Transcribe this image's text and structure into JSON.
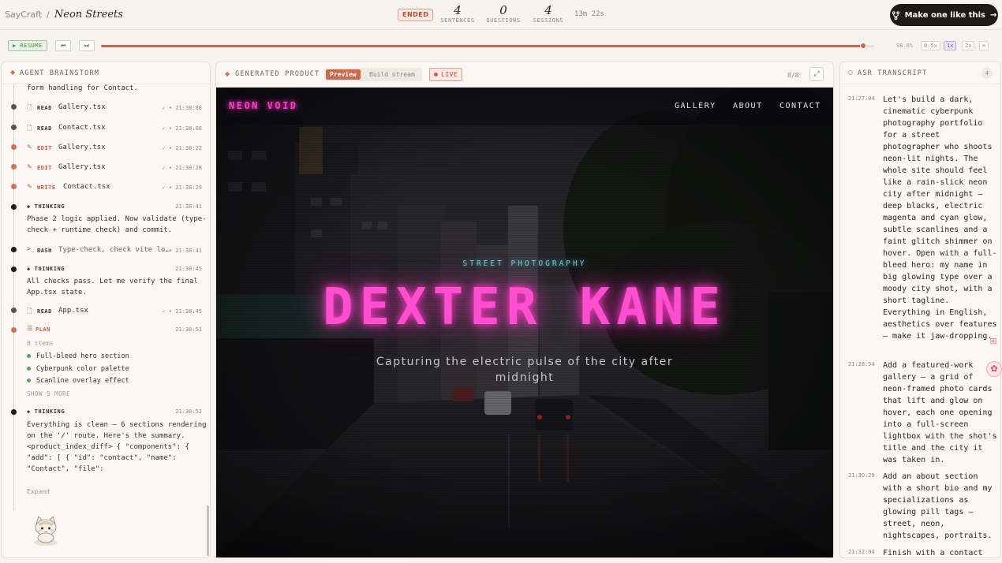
{
  "topbar": {
    "app_name": "SayCraft",
    "separator": "/",
    "project_name": "Neon Streets",
    "status": "ENDED",
    "stats": [
      {
        "value": "4",
        "label": "SENTENCES"
      },
      {
        "value": "0",
        "label": "QUESTIONS"
      },
      {
        "value": "4",
        "label": "SESSIONS"
      }
    ],
    "duration": "13m 22s",
    "make_button": "Make one like this",
    "make_button_icon": "fork-icon",
    "make_button_arrow": "→"
  },
  "playback": {
    "resume_label": "▶ RESUME",
    "prev_label": "⏮",
    "next_label": "⏭",
    "progress": 0.986,
    "progress_label": "98.6%",
    "speeds": [
      "0.5x",
      "1x",
      "2x",
      "∞"
    ],
    "active_speed": "1x",
    "accent_color": "#d0604a"
  },
  "agent": {
    "title": "AGENT BRAINSTORM",
    "header_icon": "diamond-icon",
    "truncated_text": "form handling for Contact.",
    "rows": [
      {
        "verb": "READ",
        "file": "Gallery.tsx",
        "status": "✓ •",
        "time": "21:38:08",
        "icon": "file-icon",
        "accent": false
      },
      {
        "verb": "READ",
        "file": "Contact.tsx",
        "status": "✓ •",
        "time": "21:38:08",
        "icon": "file-icon",
        "accent": false
      },
      {
        "verb": "EDIT",
        "file": "Gallery.tsx",
        "status": "✓ •",
        "time": "21:38:22",
        "icon": "pencil-icon",
        "accent": true
      },
      {
        "verb": "EDIT",
        "file": "Gallery.tsx",
        "status": "✓ •",
        "time": "21:38:28",
        "icon": "pencil-icon",
        "accent": true
      },
      {
        "verb": "WRITE",
        "file": "Contact.tsx",
        "status": "✓ •",
        "time": "21:38:29",
        "icon": "pencil-icon",
        "accent": true
      }
    ],
    "thinking1": {
      "label": "◆ THINKING",
      "time": "21:38:41",
      "text": "Phase 2 logic applied. Now validate (type-check + runtime check) and commit."
    },
    "bash": {
      "verb": "BASH",
      "text": "Type-check, check vite lo…",
      "status": "✓ •",
      "time": "21:38:41",
      "icon": "terminal-icon"
    },
    "thinking2": {
      "label": "◆ THINKING",
      "time": "21:38:45",
      "text": "All checks pass. Let me verify the final App.tsx state."
    },
    "read_app": {
      "verb": "READ",
      "file": "App.tsx",
      "status": "✓ •",
      "time": "21:38:45"
    },
    "plan": {
      "label": "PLAN",
      "time": "21:38:51",
      "count": "8 items",
      "items": [
        "Full-bleed hero section",
        "Cyberpunk color palette",
        "Scanline overlay effect"
      ],
      "more": "SHOW 5 MORE"
    },
    "thinking3": {
      "label": "◆ THINKING",
      "time": "21:38:52",
      "text": "Everything is clean — 6 sections rendering on the '/' route. Here's the summary. <product_index_diff> { \"components\": { \"add\": [ { \"id\": \"contact\", \"name\": \"Contact\", \"file\": \"src/sections/Contact.tsx …",
      "expand": "Expand"
    }
  },
  "product": {
    "title": "GENERATED PRODUCT",
    "tabs": [
      "Preview",
      "Build stream"
    ],
    "active_tab": "Preview",
    "live": "LIVE",
    "page_counter": "8/8",
    "site": {
      "logo": "NEON VOID",
      "nav": [
        "GALLERY",
        "ABOUT",
        "CONTACT"
      ],
      "eyebrow": "STREET PHOTOGRAPHY",
      "headline": "DEXTER KANE",
      "tagline": "Capturing the electric pulse of the city after midnight",
      "neon_magenta": "#ff3bc8",
      "neon_cyan": "#5fd7e0"
    }
  },
  "asr": {
    "title": "ASR TRANSCRIPT",
    "count": "4",
    "entries": [
      {
        "time": "21:27:04",
        "text": "Let's build a dark, cinematic cyberpunk photography portfolio for a street photographer who shoots neon-lit nights. The whole site should feel like a rain-slick neon city after midnight — deep blacks, electric magenta and cyan glow, subtle scanlines and a faint glitch shimmer on hover. Open with a full-bleed hero: my name in big glowing type over a moody city shot, with a short tagline. Everything in English, aesthetics over features — make it jaw-dropping."
      },
      {
        "time": "21:28:54",
        "text": "Add a featured-work gallery — a grid of neon-framed photo cards that lift and glow on hover, each one opening into a full-screen lightbox with the shot's title and the city it was taken in."
      },
      {
        "time": "21:30:29",
        "text": "Add an about section with a short bio and my specializations as glowing pill tags — street, neon, nightscapes, portraits."
      },
      {
        "time": "21:32:04",
        "text": "Finish with a contact"
      }
    ]
  }
}
